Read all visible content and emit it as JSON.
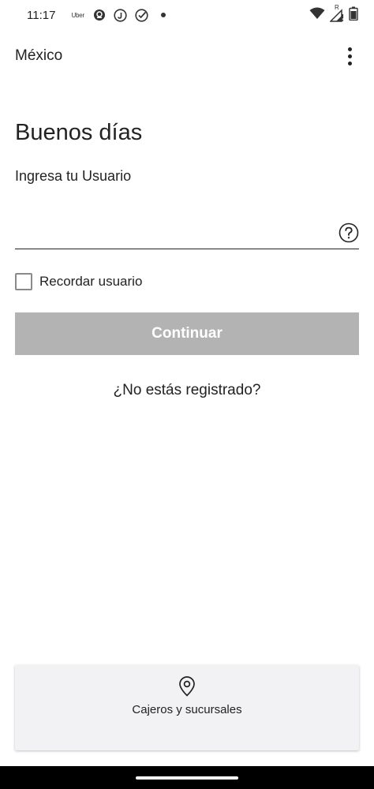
{
  "status_bar": {
    "time": "11:17",
    "uber_label": "Uber",
    "icons": [
      "uber-eats-icon",
      "j-icon",
      "check-circle-icon",
      "dot-icon"
    ],
    "right_icons": [
      "wifi-icon",
      "signal-icon",
      "battery-icon"
    ],
    "signal_badge": "R"
  },
  "app_bar": {
    "title": "México",
    "more_icon": "more-vert-icon"
  },
  "login": {
    "greeting": "Buenos días",
    "user_label": "Ingresa tu Usuario",
    "user_value": "",
    "help_icon": "help-circle-icon",
    "remember_label": "Recordar usuario",
    "remember_checked": false,
    "continue_label": "Continuar",
    "register_link": "¿No estás registrado?"
  },
  "atm_card": {
    "icon": "location-pin-icon",
    "label": "Cajeros y sucursales"
  },
  "colors": {
    "text": "#222222",
    "button_disabled": "#b3b3b3",
    "card_background": "#f2f2f4"
  }
}
